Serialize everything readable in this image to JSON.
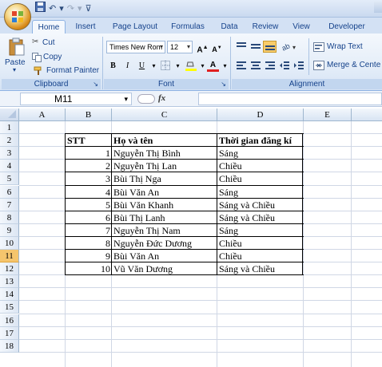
{
  "quick_access": {
    "undo_label": "↶",
    "redo_label": "↷"
  },
  "tabs": [
    {
      "label": "Home",
      "active": true
    },
    {
      "label": "Insert"
    },
    {
      "label": "Page Layout"
    },
    {
      "label": "Formulas"
    },
    {
      "label": "Data"
    },
    {
      "label": "Review"
    },
    {
      "label": "View"
    },
    {
      "label": "Developer"
    }
  ],
  "clipboard": {
    "paste_label": "Paste",
    "cut_label": "Cut",
    "copy_label": "Copy",
    "format_painter_label": "Format Painter",
    "group_label": "Clipboard"
  },
  "font": {
    "family": "Times New Rom",
    "size": "12",
    "bold": "B",
    "italic": "I",
    "underline": "U",
    "group_label": "Font"
  },
  "alignment": {
    "wrap_text_label": "Wrap Text",
    "merge_label": "Merge & Cente",
    "group_label": "Alignment"
  },
  "formula_bar": {
    "name_box": "M11",
    "fx_label": "fx",
    "value": ""
  },
  "columns": [
    "A",
    "B",
    "C",
    "D",
    "E"
  ],
  "rows": [
    "1",
    "2",
    "3",
    "4",
    "5",
    "6",
    "7",
    "8",
    "9",
    "10",
    "11",
    "12",
    "13",
    "14",
    "15",
    "16",
    "17",
    "18"
  ],
  "selected_row": "11",
  "table": {
    "headers": {
      "stt": "STT",
      "name": "Họ và tên",
      "time": "Thời gian đăng kí"
    },
    "records": [
      {
        "stt": "1",
        "name": "Nguyễn Thị Bình",
        "time": "Sáng"
      },
      {
        "stt": "2",
        "name": "Nguyễn Thị Lan",
        "time": "Chiều"
      },
      {
        "stt": "3",
        "name": "Bùi Thị Nga",
        "time": "Chiều"
      },
      {
        "stt": "4",
        "name": "Bùi Văn An",
        "time": "Sáng"
      },
      {
        "stt": "5",
        "name": "Bùi Văn Khanh",
        "time": "Sáng và Chiều"
      },
      {
        "stt": "6",
        "name": "Bùi Thị Lanh",
        "time": "Sáng và Chiều"
      },
      {
        "stt": "7",
        "name": "Nguyễn Thị Nam",
        "time": "Sáng"
      },
      {
        "stt": "8",
        "name": "Nguyễn Đức Dương",
        "time": "Chiều"
      },
      {
        "stt": "9",
        "name": "Bùi Văn An",
        "time": "Chiều"
      },
      {
        "stt": "10",
        "name": "Vũ Văn Dương",
        "time": "Sáng và Chiều"
      }
    ]
  },
  "colors": {
    "accent": "#15428b",
    "selected_row": "#f5c56d",
    "ribbon": "#dfe8f6"
  }
}
